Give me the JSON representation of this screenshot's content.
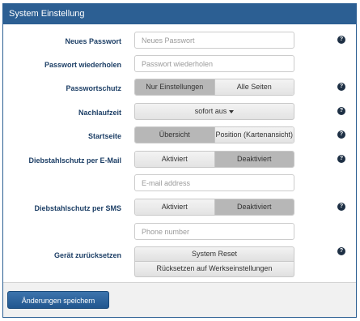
{
  "header": {
    "title": "System Einstellung"
  },
  "fields": {
    "new_password": {
      "label": "Neues Passwort",
      "placeholder": "Neues Passwort",
      "value": ""
    },
    "repeat_password": {
      "label": "Passwort wiederholen",
      "placeholder": "Passwort wiederholen",
      "value": ""
    },
    "password_protection": {
      "label": "Passwortschutz",
      "options": [
        "Nur Einstellungen",
        "Alle Seiten"
      ],
      "selected": "Nur Einstellungen"
    },
    "timeout": {
      "label": "Nachlaufzeit",
      "value": "sofort aus"
    },
    "start_page": {
      "label": "Startseite",
      "options": [
        "Übersicht",
        "Position (Kartenansicht)"
      ],
      "selected": "Übersicht"
    },
    "theft_email": {
      "label": "Diebstahlschutz per E-Mail",
      "options": [
        "Aktiviert",
        "Deaktiviert"
      ],
      "selected": "Deaktiviert",
      "email_placeholder": "E-mail address"
    },
    "theft_sms": {
      "label": "Diebstahlschutz per SMS",
      "options": [
        "Aktiviert",
        "Deaktiviert"
      ],
      "selected": "Deaktiviert",
      "phone_placeholder": "Phone number"
    },
    "reset": {
      "label": "Gerät zurücksetzen",
      "system_reset": "System Reset",
      "factory_reset": "Rücksetzen auf Werkseinstellungen"
    }
  },
  "help_icon": {
    "glyph": "?",
    "color": "#1d2f44"
  },
  "footer": {
    "save_label": "Änderungen speichern"
  },
  "colors": {
    "accent": "#2c5f93",
    "active_segment": "#b7b7b7"
  }
}
